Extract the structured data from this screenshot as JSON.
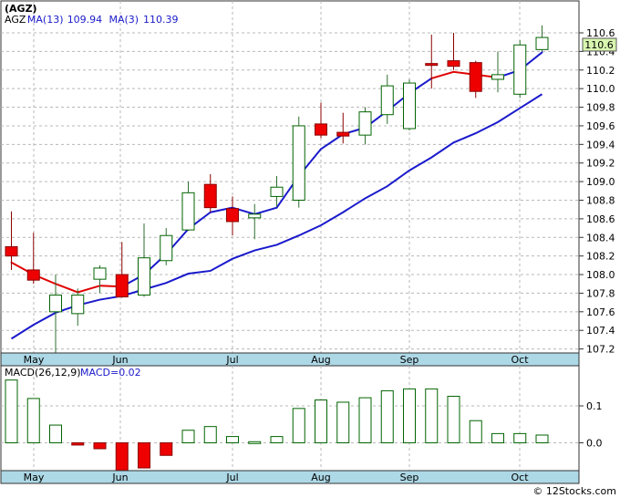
{
  "chart_data": [
    {
      "type": "candlestick",
      "title": "(AGZ)",
      "legend": [
        {
          "label": "AGZ",
          "color": "#000000"
        },
        {
          "label": "MA(13)",
          "value": "109.94",
          "color": "#1a1acc"
        },
        {
          "label": "MA(3)",
          "value": "110.39",
          "color": "#1a1acc"
        }
      ],
      "last_price_label": "110.6",
      "ylim": [
        107.1,
        110.8
      ],
      "y_ticks": [
        "110.6",
        "110.4",
        "110.2",
        "110.0",
        "109.8",
        "109.6",
        "109.4",
        "109.2",
        "109.0",
        "108.8",
        "108.6",
        "108.4",
        "108.2",
        "108.0",
        "107.8",
        "107.6",
        "107.4",
        "107.2"
      ],
      "x_labels": [
        "May",
        "Jun",
        "Jul",
        "Aug",
        "Sep",
        "Oct"
      ],
      "candles": [
        {
          "o": 108.3,
          "h": 108.68,
          "l": 108.05,
          "c": 108.2,
          "dir": "down"
        },
        {
          "o": 108.05,
          "h": 108.45,
          "l": 107.9,
          "c": 107.94,
          "dir": "down"
        },
        {
          "o": 107.6,
          "h": 108.0,
          "l": 107.15,
          "c": 107.78,
          "dir": "up"
        },
        {
          "o": 107.58,
          "h": 107.85,
          "l": 107.45,
          "c": 107.78,
          "dir": "up"
        },
        {
          "o": 107.95,
          "h": 108.1,
          "l": 107.8,
          "c": 108.07,
          "dir": "up"
        },
        {
          "o": 108.0,
          "h": 108.35,
          "l": 107.75,
          "c": 107.76,
          "dir": "down"
        },
        {
          "o": 107.78,
          "h": 108.55,
          "l": 107.76,
          "c": 108.18,
          "dir": "up"
        },
        {
          "o": 108.15,
          "h": 108.5,
          "l": 108.1,
          "c": 108.42,
          "dir": "up"
        },
        {
          "o": 108.48,
          "h": 109.0,
          "l": 108.47,
          "c": 108.88,
          "dir": "up"
        },
        {
          "o": 108.97,
          "h": 109.08,
          "l": 108.67,
          "c": 108.72,
          "dir": "down"
        },
        {
          "o": 108.71,
          "h": 108.84,
          "l": 108.42,
          "c": 108.57,
          "dir": "down"
        },
        {
          "o": 108.61,
          "h": 108.76,
          "l": 108.38,
          "c": 108.65,
          "dir": "up"
        },
        {
          "o": 108.84,
          "h": 109.06,
          "l": 108.73,
          "c": 108.94,
          "dir": "up"
        },
        {
          "o": 108.8,
          "h": 109.7,
          "l": 108.72,
          "c": 109.6,
          "dir": "up"
        },
        {
          "o": 109.62,
          "h": 109.85,
          "l": 109.47,
          "c": 109.5,
          "dir": "down"
        },
        {
          "o": 109.53,
          "h": 109.74,
          "l": 109.41,
          "c": 109.49,
          "dir": "down"
        },
        {
          "o": 109.5,
          "h": 109.8,
          "l": 109.4,
          "c": 109.75,
          "dir": "up"
        },
        {
          "o": 109.72,
          "h": 110.15,
          "l": 109.62,
          "c": 110.03,
          "dir": "up"
        },
        {
          "o": 109.57,
          "h": 110.1,
          "l": 109.55,
          "c": 110.06,
          "dir": "up"
        },
        {
          "o": 110.27,
          "h": 110.58,
          "l": 110.0,
          "c": 110.25,
          "dir": "down"
        },
        {
          "o": 110.3,
          "h": 110.6,
          "l": 110.2,
          "c": 110.24,
          "dir": "down"
        },
        {
          "o": 110.28,
          "h": 110.3,
          "l": 109.9,
          "c": 109.97,
          "dir": "down"
        },
        {
          "o": 110.1,
          "h": 110.4,
          "l": 109.96,
          "c": 110.15,
          "dir": "up"
        },
        {
          "o": 109.94,
          "h": 110.52,
          "l": 109.9,
          "c": 110.47,
          "dir": "up"
        },
        {
          "o": 110.42,
          "h": 110.68,
          "l": 110.4,
          "c": 110.55,
          "dir": "up"
        }
      ],
      "ma3": [
        108.13,
        108.0,
        107.9,
        107.81,
        107.88,
        107.87,
        108.0,
        108.22,
        108.49,
        108.67,
        108.72,
        108.65,
        108.72,
        109.06,
        109.35,
        109.51,
        109.58,
        109.76,
        109.95,
        110.11,
        110.18,
        110.15,
        110.12,
        110.2,
        110.39
      ],
      "ma3_color_segments_red": [
        [
          0,
          5
        ],
        [
          19,
          22
        ]
      ],
      "ma13": [
        107.31,
        107.46,
        107.59,
        107.67,
        107.73,
        107.77,
        107.84,
        107.91,
        108.01,
        108.04,
        108.17,
        108.26,
        108.32,
        108.42,
        108.53,
        108.67,
        108.82,
        108.95,
        109.12,
        109.26,
        109.42,
        109.52,
        109.64,
        109.79,
        109.94
      ]
    },
    {
      "type": "bar",
      "title": "MACD(26,12,9)",
      "value_label": "MACD=0.02",
      "ylim": [
        -0.075,
        0.18
      ],
      "y_ticks": [
        "0.1",
        "0.0"
      ],
      "x_labels": [
        "May",
        "Jun",
        "Jul",
        "Aug",
        "Sep",
        "Oct"
      ],
      "values": [
        0.17,
        0.12,
        0.048,
        -0.006,
        -0.016,
        -0.075,
        -0.068,
        -0.034,
        0.034,
        0.044,
        0.017,
        0.003,
        0.017,
        0.093,
        0.116,
        0.11,
        0.122,
        0.141,
        0.146,
        0.146,
        0.126,
        0.06,
        0.025,
        0.025,
        0.021
      ]
    }
  ],
  "watermark": "© 12Stocks.com"
}
